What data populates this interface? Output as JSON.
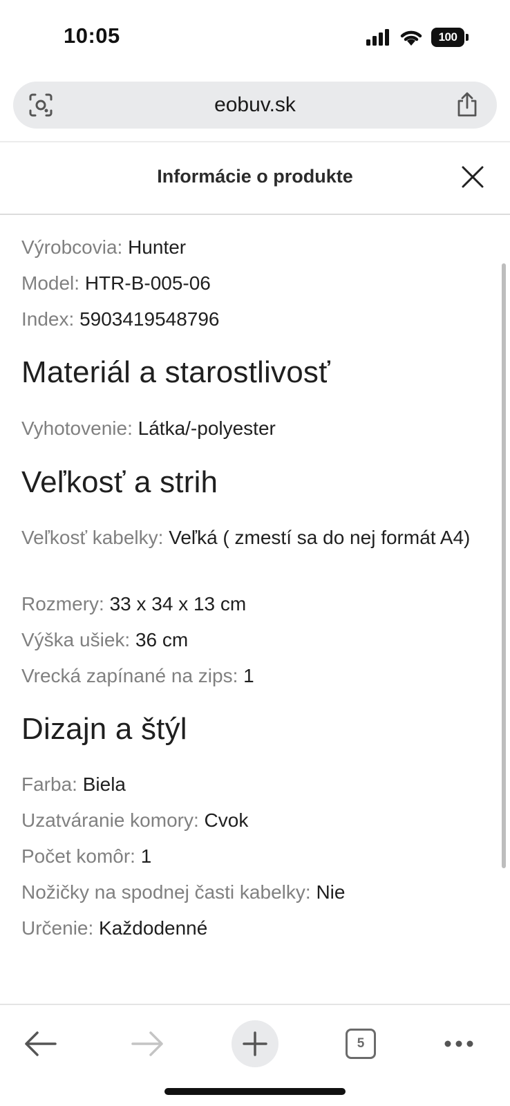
{
  "status_bar": {
    "time": "10:05",
    "battery": "100",
    "icons": [
      "cellular-signal-icon",
      "wifi-icon",
      "battery-icon"
    ]
  },
  "browser": {
    "url": "eobuv.sk",
    "left_icon": "lens-icon",
    "right_icon": "share-icon"
  },
  "modal": {
    "title": "Informácie o produkte",
    "close_icon": "close-icon"
  },
  "product_info": {
    "general": [
      {
        "label": "Výrobcovia:",
        "value": "Hunter"
      },
      {
        "label": "Model:",
        "value": "HTR-B-005-06"
      },
      {
        "label": "Index:",
        "value": "5903419548796"
      }
    ],
    "sections": [
      {
        "title": "Materiál a starostlivosť",
        "rows": [
          {
            "label": "Vyhotovenie:",
            "value": "Látka/-polyester"
          }
        ]
      },
      {
        "title": "Veľkosť a strih",
        "rows": [
          {
            "label": "Veľkosť kabelky:",
            "value": "Veľká ( zmestí sa do nej formát A4)"
          },
          {
            "label": "Rozmery:",
            "value": "33 x 34 x 13 cm"
          },
          {
            "label": "Výška ušiek:",
            "value": "36 cm"
          },
          {
            "label": "Vrecká zapínané na zips:",
            "value": "1"
          }
        ]
      },
      {
        "title": "Dizajn a štýl",
        "rows": [
          {
            "label": "Farba:",
            "value": "Biela"
          },
          {
            "label": "Uzatváranie komory:",
            "value": "Cvok"
          },
          {
            "label": "Počet komôr:",
            "value": "1"
          },
          {
            "label": "Nožičky na spodnej časti kabelky:",
            "value": "Nie"
          },
          {
            "label": "Určenie:",
            "value": "Každodenné"
          }
        ]
      }
    ]
  },
  "toolbar": {
    "tabs_count": "5",
    "icons": [
      "back-arrow-icon",
      "forward-arrow-icon",
      "new-tab-plus-icon",
      "tabs-icon",
      "more-icon"
    ]
  },
  "colors": {
    "label": "#808080",
    "value": "#1f1f1f",
    "urlbar_bg": "#e9eaec",
    "forward_disabled": "#c4c4c4"
  }
}
